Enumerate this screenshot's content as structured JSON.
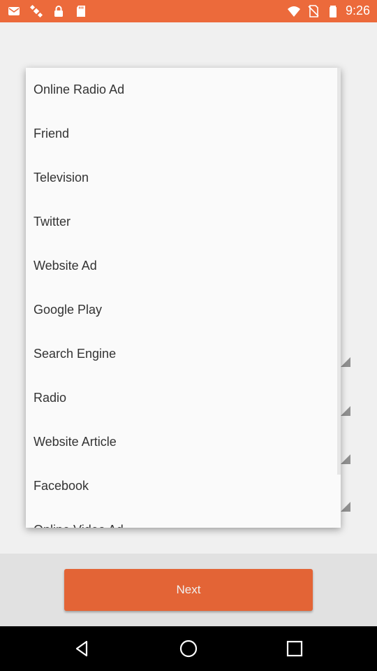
{
  "status_bar": {
    "time": "9:26",
    "icons": [
      "mail-icon",
      "satellite-icon",
      "lock-icon",
      "sd-card-icon",
      "wifi-icon",
      "no-sim-icon",
      "battery-icon"
    ]
  },
  "dropdown": {
    "options": [
      "Online Radio Ad",
      "Friend",
      "Television",
      "Twitter",
      "Website Ad",
      "Google Play",
      "Search Engine",
      "Radio",
      "Website Article",
      "Facebook",
      "Online Video Ad"
    ]
  },
  "footer": {
    "next_label": "Next"
  },
  "nav_bar": {
    "buttons": [
      "back-icon",
      "home-icon",
      "recents-icon"
    ]
  },
  "colors": {
    "accent": "#f26b3a",
    "status_bar": "#ec6a3b"
  }
}
